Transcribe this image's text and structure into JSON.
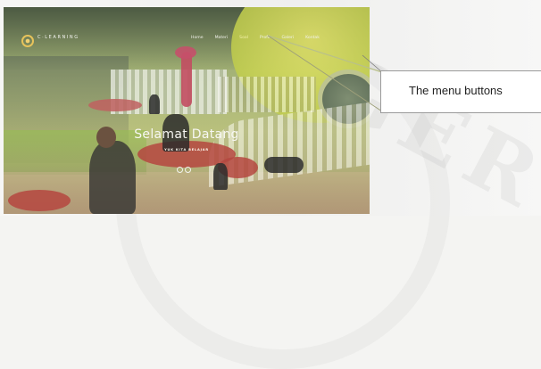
{
  "site": {
    "logo_text": "C·LEARNING",
    "menu": [
      "Home",
      "Materi",
      "Soal",
      "Profil",
      "Galeri",
      "Kontak"
    ],
    "active_menu_index": 2,
    "hero_title": "Selamat Datang",
    "hero_subtitle": "YUK KITA BELAJAR",
    "slide_count": 2
  },
  "callout": {
    "label": "The menu buttons"
  },
  "watermark": {
    "text": "GER"
  }
}
